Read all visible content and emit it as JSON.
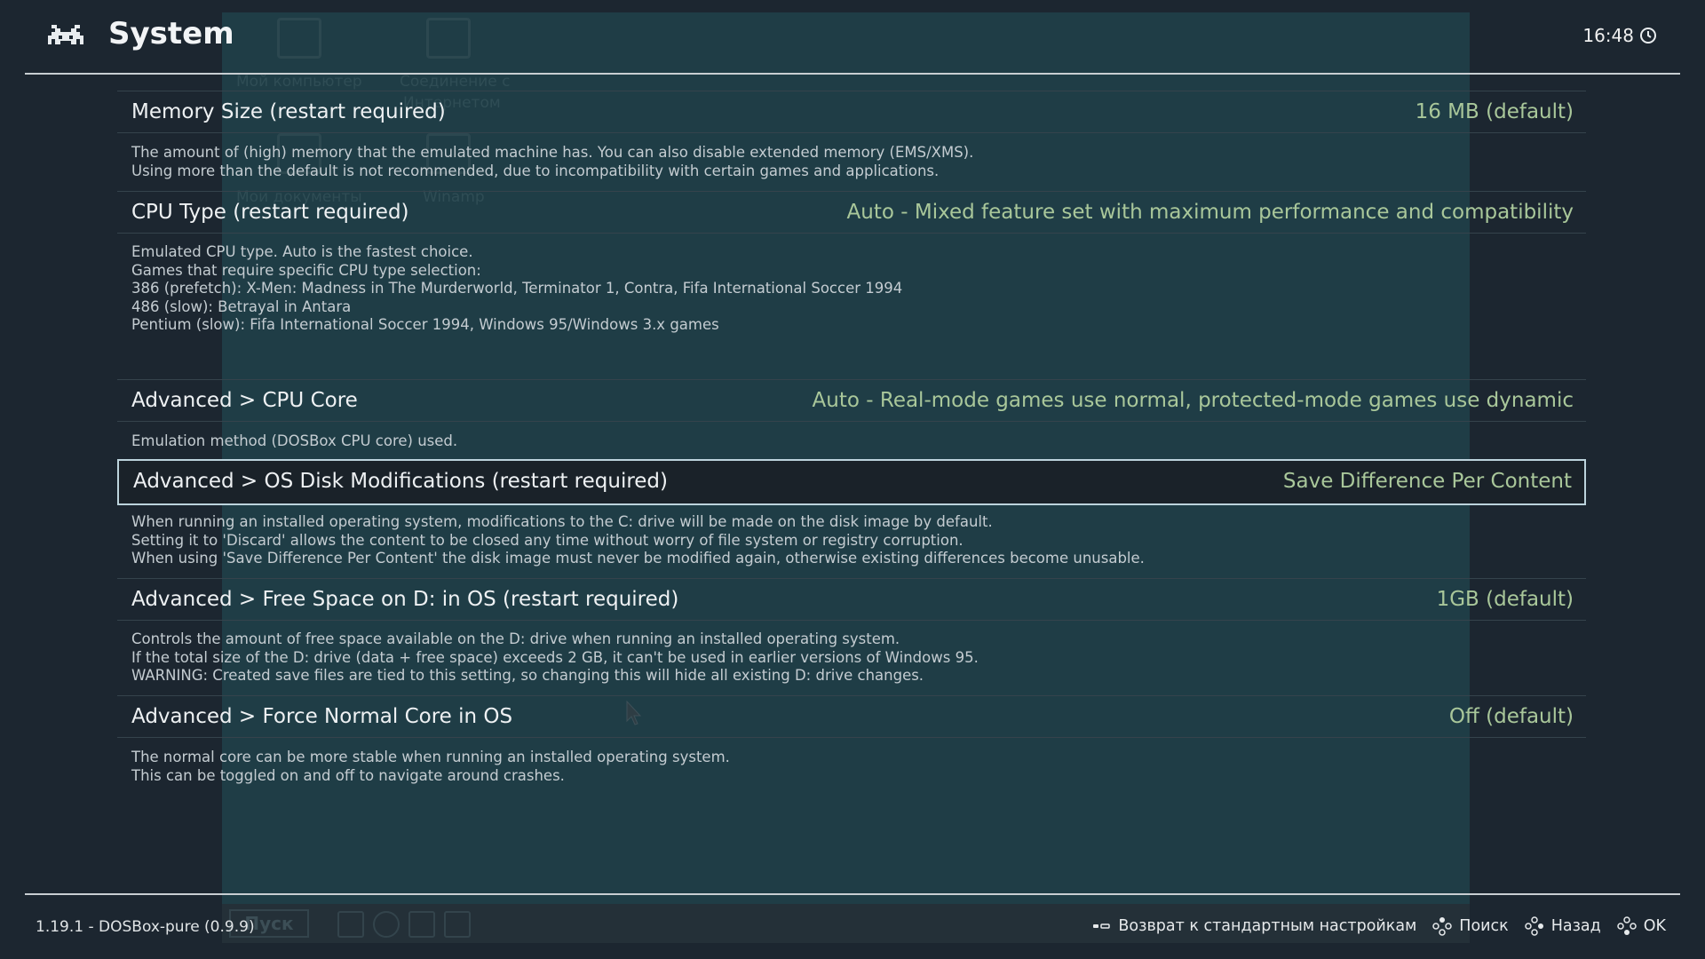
{
  "header": {
    "title": "System",
    "clock": "16:48"
  },
  "background": {
    "desktop_labels": [
      "Мой компьютер",
      "Соединение с",
      "Интернетом",
      "Мои документы",
      "Winamp"
    ],
    "start_button": "Пуск"
  },
  "settings": [
    {
      "label": "Memory Size (restart required)",
      "value": "16 MB (default)",
      "description": [
        "The amount of (high) memory that the emulated machine has. You can also disable extended memory (EMS/XMS).",
        "Using more than the default is not recommended, due to incompatibility with certain games and applications."
      ]
    },
    {
      "label": "CPU Type (restart required)",
      "value": "Auto - Mixed feature set with maximum performance and compatibility",
      "description": [
        "Emulated CPU type. Auto is the fastest choice.",
        "Games that require specific CPU type selection:",
        "386 (prefetch): X-Men: Madness in The Murderworld, Terminator 1, Contra, Fifa International Soccer 1994",
        "486 (slow): Betrayal in Antara",
        "Pentium (slow): Fifa International Soccer 1994, Windows 95/Windows 3.x games"
      ]
    },
    {
      "label": "Advanced > CPU Core",
      "value": "Auto - Real-mode games use normal, protected-mode games use dynamic",
      "description": [
        "Emulation method (DOSBox CPU core) used."
      ]
    },
    {
      "label": "Advanced > OS Disk Modifications (restart required)",
      "value": "Save Difference Per Content",
      "selected": true,
      "description": [
        "When running an installed operating system, modifications to the C: drive will be made on the disk image by default.",
        "Setting it to 'Discard' allows the content to be closed any time without worry of file system or registry corruption.",
        "When using 'Save Difference Per Content' the disk image must never be modified again, otherwise existing differences become unusable."
      ]
    },
    {
      "label": "Advanced > Free Space on D: in OS (restart required)",
      "value": "1GB (default)",
      "description": [
        "Controls the amount of free space available on the D: drive when running an installed operating system.",
        "If the total size of the D: drive (data + free space) exceeds 2 GB, it can't be used in earlier versions of Windows 95.",
        "WARNING: Created save files are tied to this setting, so changing this will hide all existing D: drive changes."
      ]
    },
    {
      "label": "Advanced > Force Normal Core in OS",
      "value": "Off (default)",
      "description": [
        "The normal core can be more stable when running an installed operating system.",
        "This can be toggled on and off to navigate around crashes."
      ]
    }
  ],
  "footer": {
    "version": "1.19.1 - DOSBox-pure (0.9.9)",
    "hints": [
      {
        "icon": "select-button-icon",
        "label": "Возврат к стандартным настройкам"
      },
      {
        "icon": "y-button-icon",
        "label": "Поиск"
      },
      {
        "icon": "b-button-icon",
        "label": "Назад"
      },
      {
        "icon": "a-button-icon",
        "label": "OK"
      }
    ]
  },
  "colors": {
    "background": "#1c2630",
    "value_text": "#a9c79a",
    "selection_border": "#bcd3dc"
  }
}
